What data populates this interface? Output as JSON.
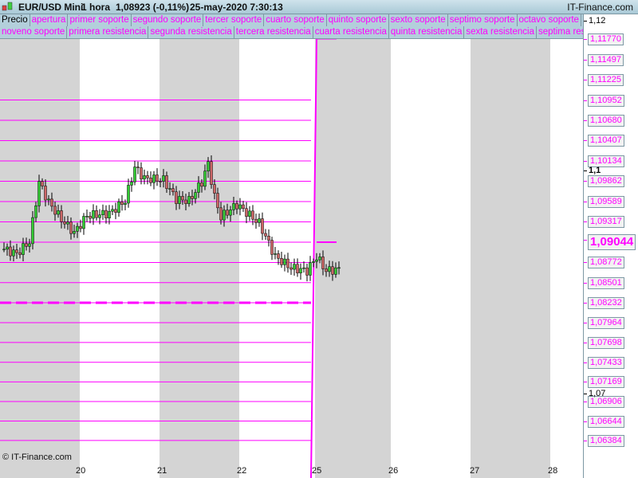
{
  "header": {
    "instrument": "EUR/USD Mini",
    "timeframe": "1 hora",
    "price": "1,08923 (-0,11%)",
    "datetime": "25-may-2020 7:30:13",
    "brand": "IT-Finance.com",
    "icon": "candlestick-icon"
  },
  "legend_row1": [
    "Precio",
    "apertura",
    "primer soporte",
    "segundo soporte",
    "tercer soporte",
    "cuarto soporte",
    "quinto soporte",
    "sexto soporte",
    "septimo soporte",
    "octavo soporte"
  ],
  "legend_row2": [
    "noveno soporte",
    "primera resistencia",
    "segunda resistencia",
    "tercera resistencia",
    "cuarta resistencia",
    "quinta resistencia",
    "sexta resistencia",
    "septima resistencia"
  ],
  "copyright": "© IT-Finance.com",
  "colors": {
    "level": "#ff00ff",
    "up": "#33cc33",
    "down": "#cc6666"
  },
  "chart_data": {
    "type": "candlestick",
    "x_ticks": [
      "20",
      "21",
      "22",
      "25",
      "26",
      "27",
      "28"
    ],
    "level_labels": [
      "1,11770",
      "1,11497",
      "1,11225",
      "1,10952",
      "1,10680",
      "1,10407",
      "1,10134",
      "1,09862",
      "1,09589",
      "1,09317",
      "1,09044",
      "1,08772",
      "1,08501",
      "1,08232",
      "1,07964",
      "1,07698",
      "1,07433",
      "1,07169",
      "1,06906",
      "1,06644",
      "1,06384"
    ],
    "axis_ticks": [
      "1,12",
      "1,1",
      "1,07"
    ],
    "current": "1,09044",
    "levels": [
      1.10952,
      1.1068,
      1.10407,
      1.10134,
      1.09862,
      1.09589,
      1.09317,
      1.09044,
      1.08772,
      1.08501,
      1.08232,
      1.07964,
      1.07698,
      1.07433,
      1.07169,
      1.06906,
      1.06644,
      1.06384
    ],
    "apertura": 1.08232,
    "price_path": [
      [
        0,
        1.0895
      ],
      [
        4,
        1.0889
      ],
      [
        8,
        1.0905
      ],
      [
        11,
        1.0985
      ],
      [
        14,
        1.0958
      ],
      [
        18,
        1.0935
      ],
      [
        22,
        1.0917
      ],
      [
        26,
        1.094
      ],
      [
        33,
        1.0943
      ],
      [
        38,
        1.096
      ],
      [
        41,
        1.1005
      ],
      [
        44,
        1.099
      ],
      [
        50,
        1.0988
      ],
      [
        54,
        1.0962
      ],
      [
        58,
        1.096
      ],
      [
        62,
        1.0985
      ],
      [
        64,
        1.101
      ],
      [
        66,
        1.0965
      ],
      [
        68,
        1.0938
      ],
      [
        73,
        1.0955
      ],
      [
        80,
        1.093
      ],
      [
        85,
        1.0885
      ],
      [
        90,
        1.087
      ],
      [
        95,
        1.0866
      ],
      [
        98,
        1.0885
      ],
      [
        101,
        1.0866
      ],
      [
        105,
        1.0868
      ]
    ]
  }
}
